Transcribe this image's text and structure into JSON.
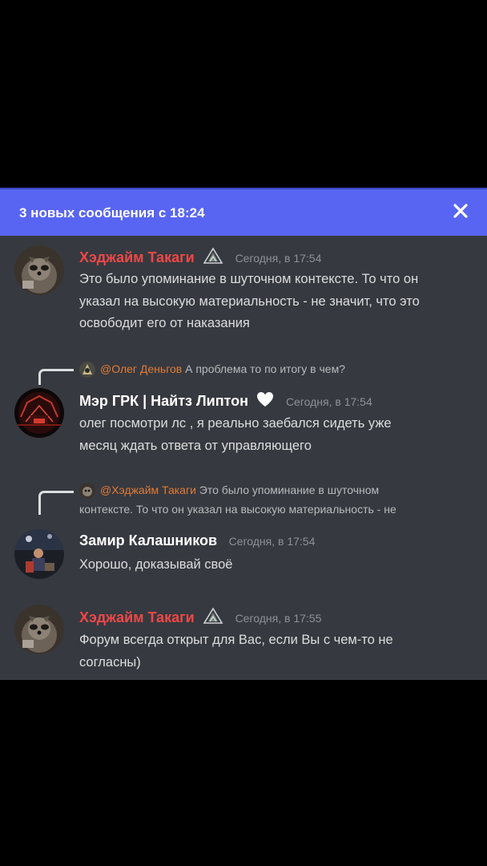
{
  "banner": {
    "text": "3 новых сообщения с 18:24",
    "close_icon": "close-icon"
  },
  "colors": {
    "banner_bg": "#5865f2",
    "panel_bg": "#36393f",
    "username_red": "#f04747",
    "mention_orange": "#e07b39"
  },
  "messages": [
    {
      "username": "Хэджайм Такаги",
      "badge_icon": "triangle-badge-icon",
      "timestamp": "Сегодня, в 17:54",
      "lines": [
        "Это было упоминание в шуточном контексте. То что он",
        "указал на высокую материальность - не значит, что это",
        "освободит его от наказания"
      ]
    },
    {
      "reply": {
        "mention": "@Олег Деньгов",
        "text": "А проблема то по итогу в чем?"
      },
      "username": "Мэр ГРК | Найтз  Липтон",
      "badge_icon": "white-heart-icon",
      "timestamp": "Сегодня, в 17:54",
      "lines": [
        "олег посмотри лс , я реально заебался сидеть уже",
        "месяц ждать ответа от управляющего"
      ]
    },
    {
      "reply": {
        "mention": "@Хэджайм Такаги",
        "text_line1": "Это было упоминание в шуточном",
        "text_line2": "контексте. То что он указал на высокую материальность - не"
      },
      "username": "Замир Калашников",
      "timestamp": "Сегодня, в 17:54",
      "lines": [
        "Хорошо, доказывай своё"
      ]
    },
    {
      "username": "Хэджайм Такаги",
      "badge_icon": "triangle-badge-icon",
      "timestamp": "Сегодня, в 17:55",
      "lines": [
        "Форум всегда открыт для Вас, если Вы с чем-то не",
        "согласны)"
      ]
    }
  ]
}
